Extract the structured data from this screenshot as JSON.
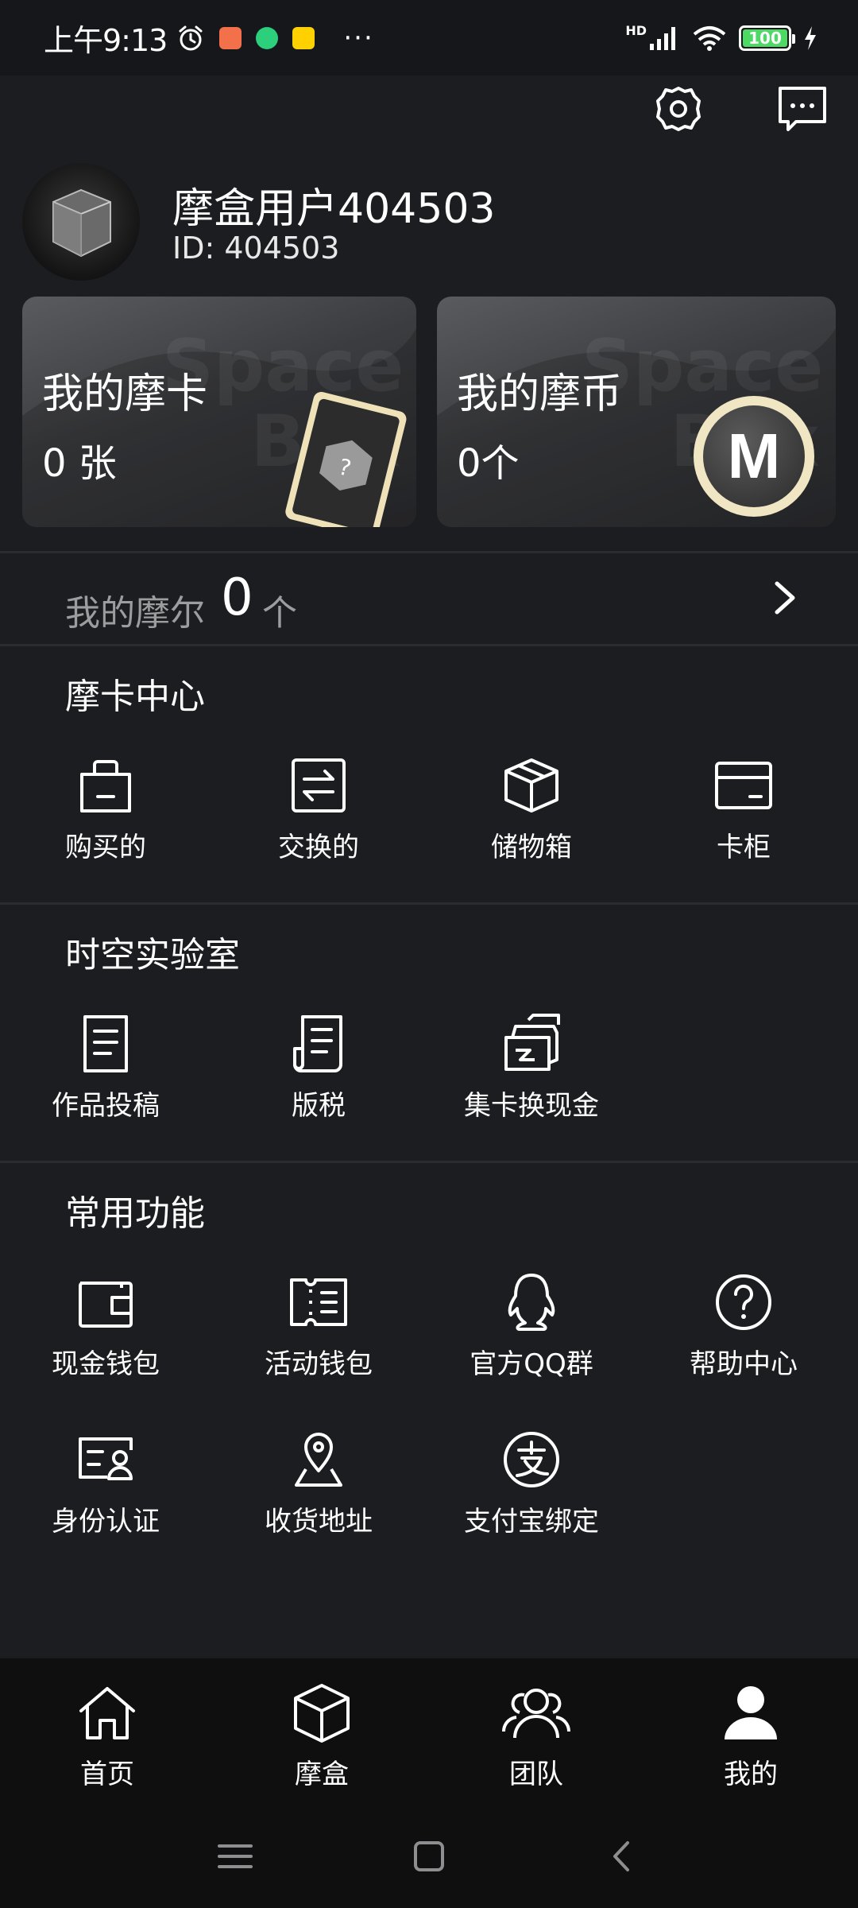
{
  "status_bar": {
    "time": "上午9:13",
    "network": "HD",
    "battery": "100"
  },
  "profile": {
    "username": "摩盒用户404503",
    "id_text": "ID: 404503"
  },
  "cards": [
    {
      "title": "我的摩卡",
      "value": "0 张",
      "watermark": "Space Box"
    },
    {
      "title": "我的摩币",
      "value": "0个",
      "watermark": "Space Box",
      "coin_letter": "M"
    }
  ],
  "moer": {
    "label": "我的摩尔",
    "count": "0",
    "unit": "个"
  },
  "sections": [
    {
      "title": "摩卡中心",
      "items": [
        {
          "label": "购买的",
          "icon": "shopping-bag-icon"
        },
        {
          "label": "交换的",
          "icon": "exchange-icon"
        },
        {
          "label": "储物箱",
          "icon": "box-icon"
        },
        {
          "label": "卡柜",
          "icon": "card-icon"
        }
      ]
    },
    {
      "title": "时空实验室",
      "items": [
        {
          "label": "作品投稿",
          "icon": "document-icon"
        },
        {
          "label": "版税",
          "icon": "receipt-icon"
        },
        {
          "label": "集卡换现金",
          "icon": "cards-cash-icon"
        }
      ]
    },
    {
      "title": "常用功能",
      "items": [
        {
          "label": "现金钱包",
          "icon": "wallet-icon"
        },
        {
          "label": "活动钱包",
          "icon": "ticket-icon"
        },
        {
          "label": "官方QQ群",
          "icon": "qq-icon"
        },
        {
          "label": "帮助中心",
          "icon": "help-icon"
        },
        {
          "label": "身份认证",
          "icon": "id-card-icon"
        },
        {
          "label": "收货地址",
          "icon": "location-icon"
        },
        {
          "label": "支付宝绑定",
          "icon": "alipay-icon"
        }
      ]
    }
  ],
  "bottom_nav": [
    {
      "label": "首页",
      "icon": "home-icon"
    },
    {
      "label": "摩盒",
      "icon": "cube-icon"
    },
    {
      "label": "团队",
      "icon": "team-icon"
    },
    {
      "label": "我的",
      "icon": "user-icon",
      "active": true
    }
  ]
}
